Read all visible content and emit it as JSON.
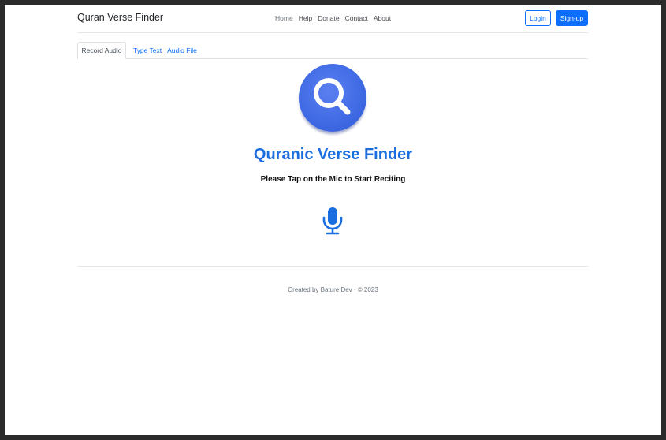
{
  "navbar": {
    "brand": "Quran Verse Finder",
    "links": [
      "Home",
      "Help",
      "Donate",
      "Contact",
      "About"
    ],
    "login_label": "Login",
    "signup_label": "Sign-up"
  },
  "tabs": [
    "Record Audio",
    "Type Text",
    "Audio File"
  ],
  "main": {
    "logo_icon": "search-icon",
    "title": "Quranic Verse Finder",
    "subtitle": "Please Tap on the Mic to Start Reciting",
    "mic_icon": "microphone-icon"
  },
  "footer": {
    "text": "Created by Bature Dev · © 2023"
  },
  "colors": {
    "primary": "#0d6efd",
    "title": "#1a6ee0",
    "logo": "#3f6ae4"
  }
}
